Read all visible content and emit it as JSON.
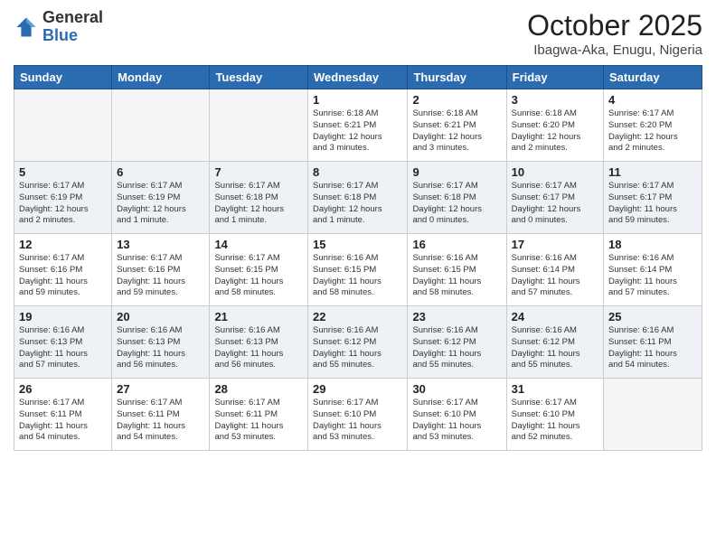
{
  "logo": {
    "general": "General",
    "blue": "Blue"
  },
  "title": "October 2025",
  "location": "Ibagwa-Aka, Enugu, Nigeria",
  "days_of_week": [
    "Sunday",
    "Monday",
    "Tuesday",
    "Wednesday",
    "Thursday",
    "Friday",
    "Saturday"
  ],
  "weeks": [
    [
      {
        "num": "",
        "info": ""
      },
      {
        "num": "",
        "info": ""
      },
      {
        "num": "",
        "info": ""
      },
      {
        "num": "1",
        "info": "Sunrise: 6:18 AM\nSunset: 6:21 PM\nDaylight: 12 hours\nand 3 minutes."
      },
      {
        "num": "2",
        "info": "Sunrise: 6:18 AM\nSunset: 6:21 PM\nDaylight: 12 hours\nand 3 minutes."
      },
      {
        "num": "3",
        "info": "Sunrise: 6:18 AM\nSunset: 6:20 PM\nDaylight: 12 hours\nand 2 minutes."
      },
      {
        "num": "4",
        "info": "Sunrise: 6:17 AM\nSunset: 6:20 PM\nDaylight: 12 hours\nand 2 minutes."
      }
    ],
    [
      {
        "num": "5",
        "info": "Sunrise: 6:17 AM\nSunset: 6:19 PM\nDaylight: 12 hours\nand 2 minutes."
      },
      {
        "num": "6",
        "info": "Sunrise: 6:17 AM\nSunset: 6:19 PM\nDaylight: 12 hours\nand 1 minute."
      },
      {
        "num": "7",
        "info": "Sunrise: 6:17 AM\nSunset: 6:18 PM\nDaylight: 12 hours\nand 1 minute."
      },
      {
        "num": "8",
        "info": "Sunrise: 6:17 AM\nSunset: 6:18 PM\nDaylight: 12 hours\nand 1 minute."
      },
      {
        "num": "9",
        "info": "Sunrise: 6:17 AM\nSunset: 6:18 PM\nDaylight: 12 hours\nand 0 minutes."
      },
      {
        "num": "10",
        "info": "Sunrise: 6:17 AM\nSunset: 6:17 PM\nDaylight: 12 hours\nand 0 minutes."
      },
      {
        "num": "11",
        "info": "Sunrise: 6:17 AM\nSunset: 6:17 PM\nDaylight: 11 hours\nand 59 minutes."
      }
    ],
    [
      {
        "num": "12",
        "info": "Sunrise: 6:17 AM\nSunset: 6:16 PM\nDaylight: 11 hours\nand 59 minutes."
      },
      {
        "num": "13",
        "info": "Sunrise: 6:17 AM\nSunset: 6:16 PM\nDaylight: 11 hours\nand 59 minutes."
      },
      {
        "num": "14",
        "info": "Sunrise: 6:17 AM\nSunset: 6:15 PM\nDaylight: 11 hours\nand 58 minutes."
      },
      {
        "num": "15",
        "info": "Sunrise: 6:16 AM\nSunset: 6:15 PM\nDaylight: 11 hours\nand 58 minutes."
      },
      {
        "num": "16",
        "info": "Sunrise: 6:16 AM\nSunset: 6:15 PM\nDaylight: 11 hours\nand 58 minutes."
      },
      {
        "num": "17",
        "info": "Sunrise: 6:16 AM\nSunset: 6:14 PM\nDaylight: 11 hours\nand 57 minutes."
      },
      {
        "num": "18",
        "info": "Sunrise: 6:16 AM\nSunset: 6:14 PM\nDaylight: 11 hours\nand 57 minutes."
      }
    ],
    [
      {
        "num": "19",
        "info": "Sunrise: 6:16 AM\nSunset: 6:13 PM\nDaylight: 11 hours\nand 57 minutes."
      },
      {
        "num": "20",
        "info": "Sunrise: 6:16 AM\nSunset: 6:13 PM\nDaylight: 11 hours\nand 56 minutes."
      },
      {
        "num": "21",
        "info": "Sunrise: 6:16 AM\nSunset: 6:13 PM\nDaylight: 11 hours\nand 56 minutes."
      },
      {
        "num": "22",
        "info": "Sunrise: 6:16 AM\nSunset: 6:12 PM\nDaylight: 11 hours\nand 55 minutes."
      },
      {
        "num": "23",
        "info": "Sunrise: 6:16 AM\nSunset: 6:12 PM\nDaylight: 11 hours\nand 55 minutes."
      },
      {
        "num": "24",
        "info": "Sunrise: 6:16 AM\nSunset: 6:12 PM\nDaylight: 11 hours\nand 55 minutes."
      },
      {
        "num": "25",
        "info": "Sunrise: 6:16 AM\nSunset: 6:11 PM\nDaylight: 11 hours\nand 54 minutes."
      }
    ],
    [
      {
        "num": "26",
        "info": "Sunrise: 6:17 AM\nSunset: 6:11 PM\nDaylight: 11 hours\nand 54 minutes."
      },
      {
        "num": "27",
        "info": "Sunrise: 6:17 AM\nSunset: 6:11 PM\nDaylight: 11 hours\nand 54 minutes."
      },
      {
        "num": "28",
        "info": "Sunrise: 6:17 AM\nSunset: 6:11 PM\nDaylight: 11 hours\nand 53 minutes."
      },
      {
        "num": "29",
        "info": "Sunrise: 6:17 AM\nSunset: 6:10 PM\nDaylight: 11 hours\nand 53 minutes."
      },
      {
        "num": "30",
        "info": "Sunrise: 6:17 AM\nSunset: 6:10 PM\nDaylight: 11 hours\nand 53 minutes."
      },
      {
        "num": "31",
        "info": "Sunrise: 6:17 AM\nSunset: 6:10 PM\nDaylight: 11 hours\nand 52 minutes."
      },
      {
        "num": "",
        "info": ""
      }
    ]
  ]
}
